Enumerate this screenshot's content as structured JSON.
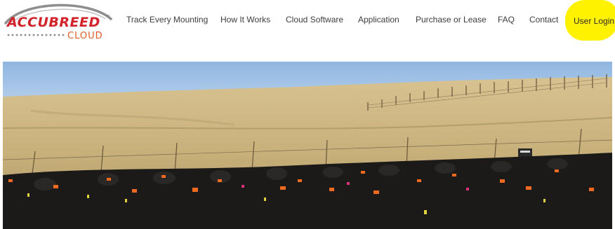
{
  "logo": {
    "primary_text": "ACCUBREED",
    "trademark": "™",
    "secondary_text": "CLOUD"
  },
  "nav": {
    "items": [
      {
        "label": "Track Every Mounting"
      },
      {
        "label": "How It Works"
      },
      {
        "label": "Cloud Software"
      },
      {
        "label": "Application"
      },
      {
        "label": "Purchase or Lease"
      },
      {
        "label": "FAQ"
      },
      {
        "label": "Contact"
      }
    ],
    "login": {
      "label": "User Login"
    }
  },
  "hero": {
    "subject": "herd of black cattle with orange ear tags in a fenced prairie pasture",
    "colors": {
      "sky": "#9cc0e6",
      "grass": "#c9b37c",
      "cattle": "#1b1a19",
      "ear_tag": "#f06a1f"
    }
  },
  "colors": {
    "brand_red": "#d3232a",
    "brand_orange": "#e35b27",
    "highlight": "#fff200",
    "nav_text": "#3d3d3d"
  }
}
